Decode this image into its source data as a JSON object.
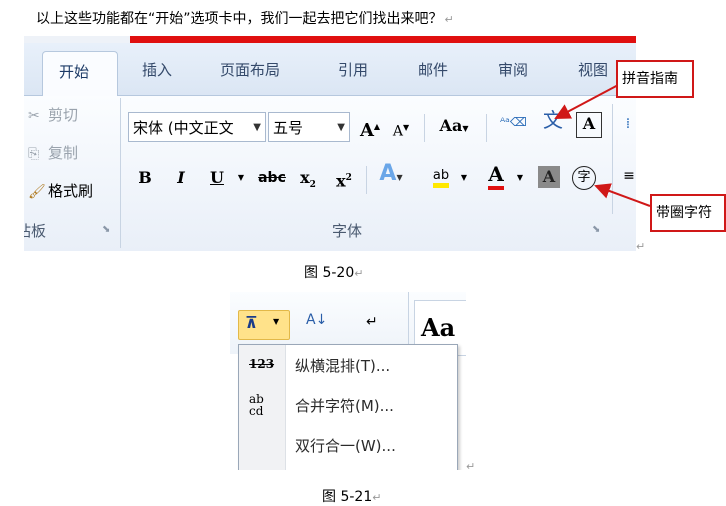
{
  "intro": "以上这些功能都在“开始”选项卡中，我们一起去把它们找出来吧？",
  "return_mark": "↵",
  "ribbon": {
    "tabs": [
      "开始",
      "插入",
      "页面布局",
      "引用",
      "邮件",
      "审阅",
      "视图"
    ],
    "clipboard": {
      "cut": "剪切",
      "copy": "复制",
      "format_painter": "格式刷",
      "group_label_partial": "站板"
    },
    "font": {
      "font_name": "宋体 (中文正文",
      "font_size": "五号",
      "group_label": "字体",
      "buttons": {
        "grow": "A",
        "shrink": "A",
        "change_case": "Aa",
        "bold": "B",
        "italic": "I",
        "underline": "U",
        "strikethrough": "abc",
        "subscript": "x",
        "superscript": "x",
        "highlight": "ab",
        "font_color": "A",
        "char_shading": "A",
        "enclose": "字",
        "phonetic": "文",
        "char_border": "A"
      }
    }
  },
  "callouts": {
    "pinyin": "拼音指南",
    "enclosed": "带圈字符"
  },
  "captions": {
    "fig1": "图 5-20",
    "fig2": "图 5-21"
  },
  "menu": {
    "items": [
      {
        "label": "纵横混排(T)...",
        "icon": "123"
      },
      {
        "label": "合并字符(M)...",
        "icon": "ab"
      },
      {
        "label": "双行合一(W)...",
        "icon": ""
      }
    ],
    "partial_text": "Aa"
  },
  "colors": {
    "accent_red": "#d01818",
    "highlight_yellow": "#ffe800",
    "font_red": "#e01010"
  }
}
